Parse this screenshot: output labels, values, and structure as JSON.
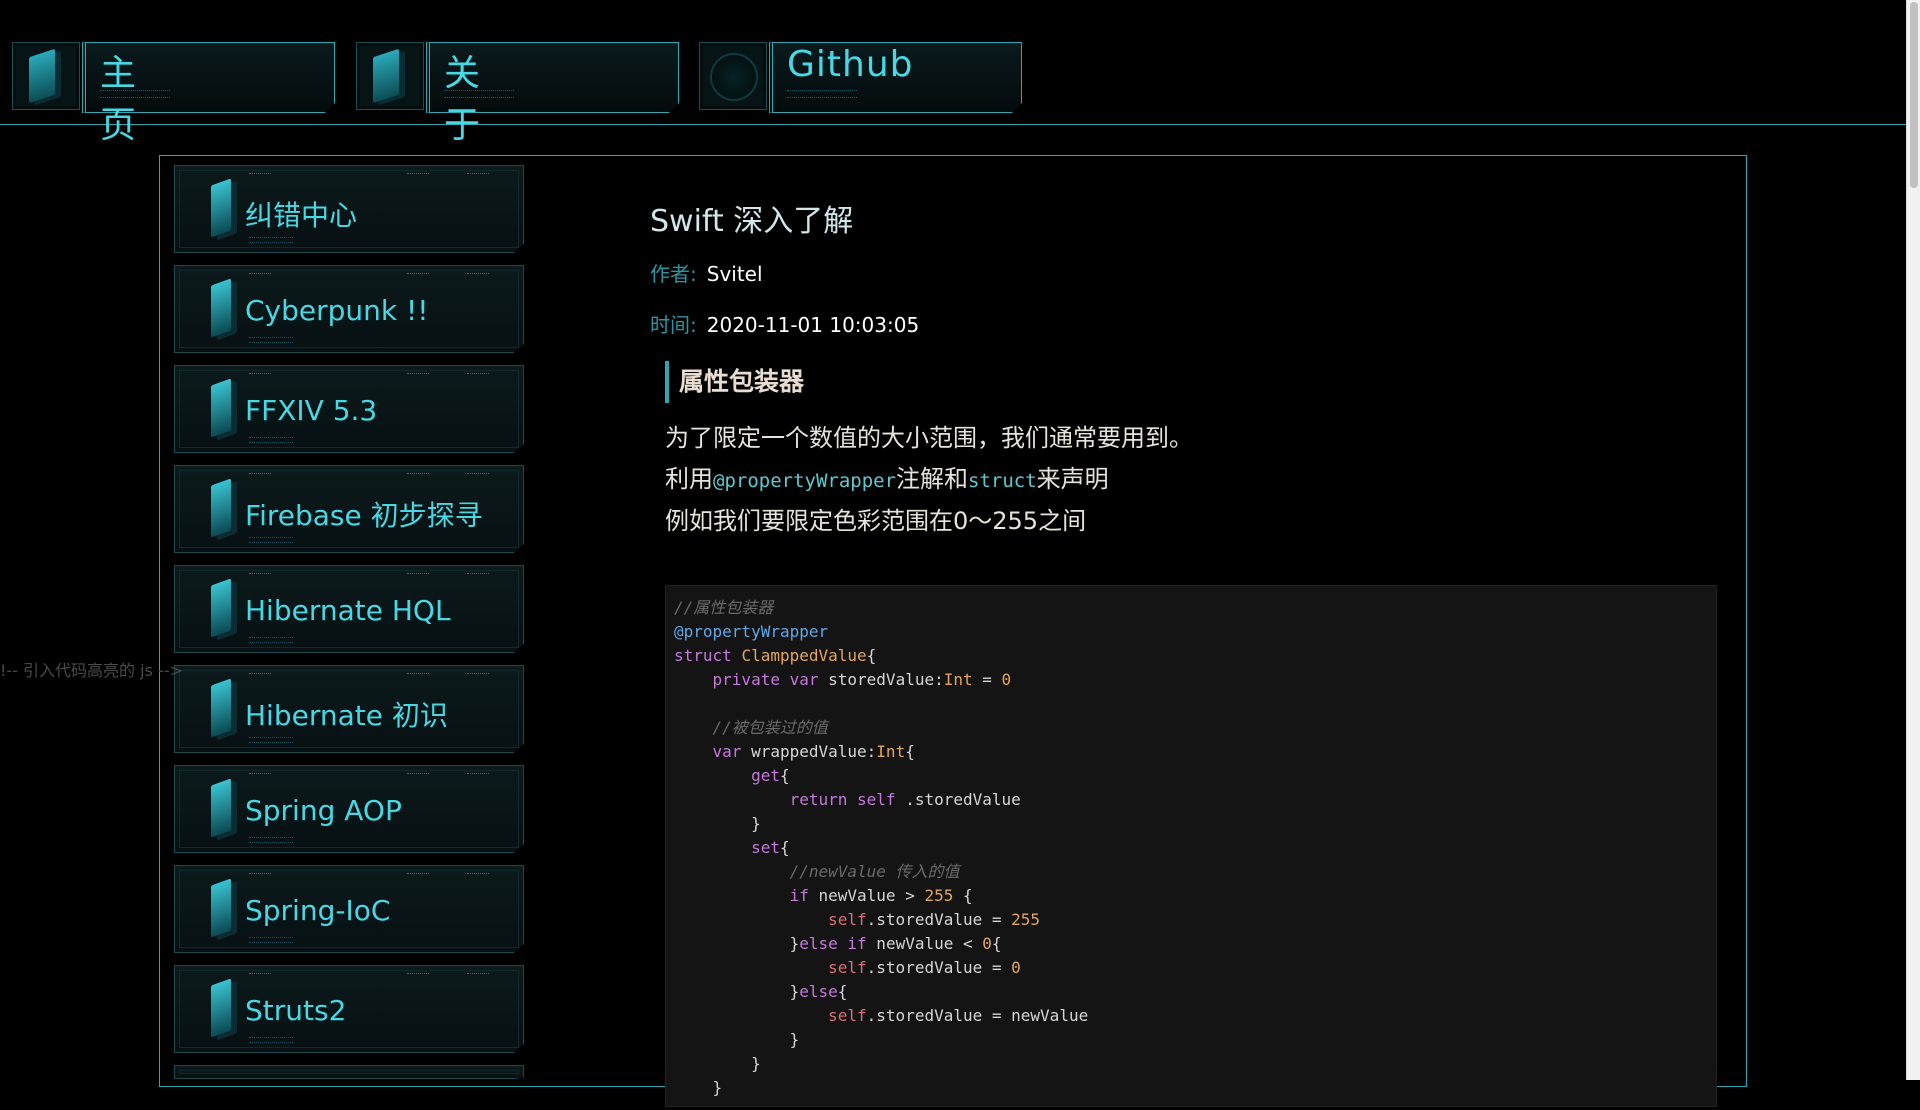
{
  "nav": [
    {
      "label": "主页",
      "icon": "chip-icon"
    },
    {
      "label": "关于",
      "icon": "chip-icon"
    },
    {
      "label": "Github",
      "icon": "circle-icon"
    }
  ],
  "sidebar": {
    "items": [
      {
        "label": "纠错中心"
      },
      {
        "label": "Cyberpunk !!"
      },
      {
        "label": "FFXIV 5.3"
      },
      {
        "label": "Firebase 初步探寻"
      },
      {
        "label": "Hibernate HQL"
      },
      {
        "label": "Hibernate 初识"
      },
      {
        "label": "Spring AOP"
      },
      {
        "label": "Spring-IoC"
      },
      {
        "label": "Struts2"
      }
    ]
  },
  "stray_comment": "!-- 引入代码高亮的 js -->",
  "article": {
    "title": "Swift 深入了解",
    "author_key": "作者:",
    "author": "Svitel",
    "time_key": "时间:",
    "time": "2020-11-01 10:03:05",
    "section_heading": "属性包装器",
    "para1": "为了限定一个数值的大小范围，我们通常要用到。",
    "para2_a": "利用",
    "para2_code1": "@propertyWrapper",
    "para2_b": "注解和",
    "para2_code2": "struct",
    "para2_c": "来声明",
    "para3": "例如我们要限定色彩范围在0～255之间"
  },
  "colors": {
    "accent": "#2fa7b0",
    "nav_text": "#48d8e4",
    "background": "#000000"
  }
}
